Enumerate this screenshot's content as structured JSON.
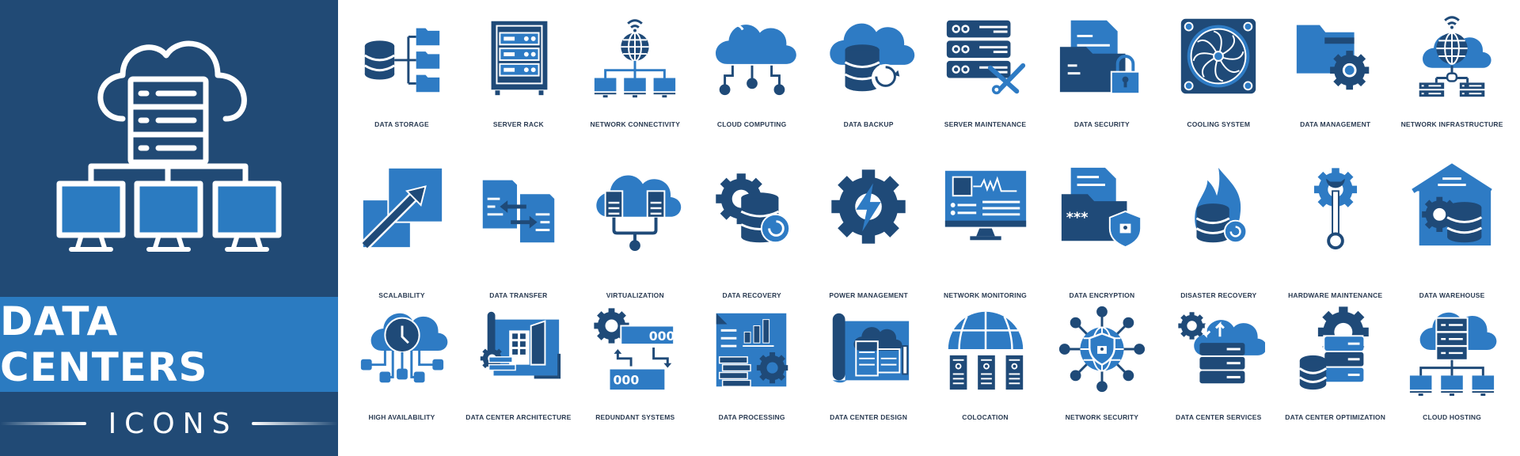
{
  "hero": {
    "title": "DATA CENTERS",
    "subtitle": "ICONS",
    "icon": "cloud-server-network-icon"
  },
  "colors": {
    "panel_dark": "#214a75",
    "banner_blue": "#2b7bc1",
    "icon_dark": "#1f4a78",
    "icon_light": "#2e7bc4",
    "label_text": "#2a3b52",
    "background": "#ffffff"
  },
  "rows": [
    {
      "items": [
        {
          "label": "DATA STORAGE",
          "icon": "data-storage-icon"
        },
        {
          "label": "SERVER RACK",
          "icon": "server-rack-icon"
        },
        {
          "label": "NETWORK CONNECTIVITY",
          "icon": "network-connectivity-icon"
        },
        {
          "label": "CLOUD COMPUTING",
          "icon": "cloud-computing-icon"
        },
        {
          "label": "DATA BACKUP",
          "icon": "data-backup-icon"
        },
        {
          "label": "SERVER MAINTENANCE",
          "icon": "server-maintenance-icon"
        },
        {
          "label": "DATA SECURITY",
          "icon": "data-security-icon"
        },
        {
          "label": "COOLING SYSTEM",
          "icon": "cooling-system-icon"
        },
        {
          "label": "DATA MANAGEMENT",
          "icon": "data-management-icon"
        },
        {
          "label": "NETWORK INFRASTRUCTURE",
          "icon": "network-infrastructure-icon"
        }
      ]
    },
    {
      "items": [
        {
          "label": "SCALABILITY",
          "icon": "scalability-icon"
        },
        {
          "label": "DATA TRANSFER",
          "icon": "data-transfer-icon"
        },
        {
          "label": "VIRTUALIZATION",
          "icon": "virtualization-icon"
        },
        {
          "label": "DATA RECOVERY",
          "icon": "data-recovery-icon"
        },
        {
          "label": "POWER MANAGEMENT",
          "icon": "power-management-icon"
        },
        {
          "label": "NETWORK MONITORING",
          "icon": "network-monitoring-icon"
        },
        {
          "label": "DATA ENCRYPTION",
          "icon": "data-encryption-icon"
        },
        {
          "label": "DISASTER RECOVERY",
          "icon": "disaster-recovery-icon"
        },
        {
          "label": "HARDWARE MAINTENANCE",
          "icon": "hardware-maintenance-icon"
        },
        {
          "label": "DATA WAREHOUSE",
          "icon": "data-warehouse-icon"
        }
      ]
    },
    {
      "items": [
        {
          "label": "HIGH AVAILABILITY",
          "icon": "high-availability-icon"
        },
        {
          "label": "DATA CENTER ARCHITECTURE",
          "icon": "data-center-architecture-icon"
        },
        {
          "label": "REDUNDANT SYSTEMS",
          "icon": "redundant-systems-icon"
        },
        {
          "label": "DATA PROCESSING",
          "icon": "data-processing-icon"
        },
        {
          "label": "DATA CENTER DESIGN",
          "icon": "data-center-design-icon"
        },
        {
          "label": "COLOCATION",
          "icon": "colocation-icon"
        },
        {
          "label": "NETWORK SECURITY",
          "icon": "network-security-icon"
        },
        {
          "label": "DATA CENTER SERVICES",
          "icon": "data-center-services-icon"
        },
        {
          "label": "DATA CENTER OPTIMIZATION",
          "icon": "data-center-optimization-icon"
        },
        {
          "label": "CLOUD HOSTING",
          "icon": "cloud-hosting-icon"
        }
      ]
    }
  ]
}
